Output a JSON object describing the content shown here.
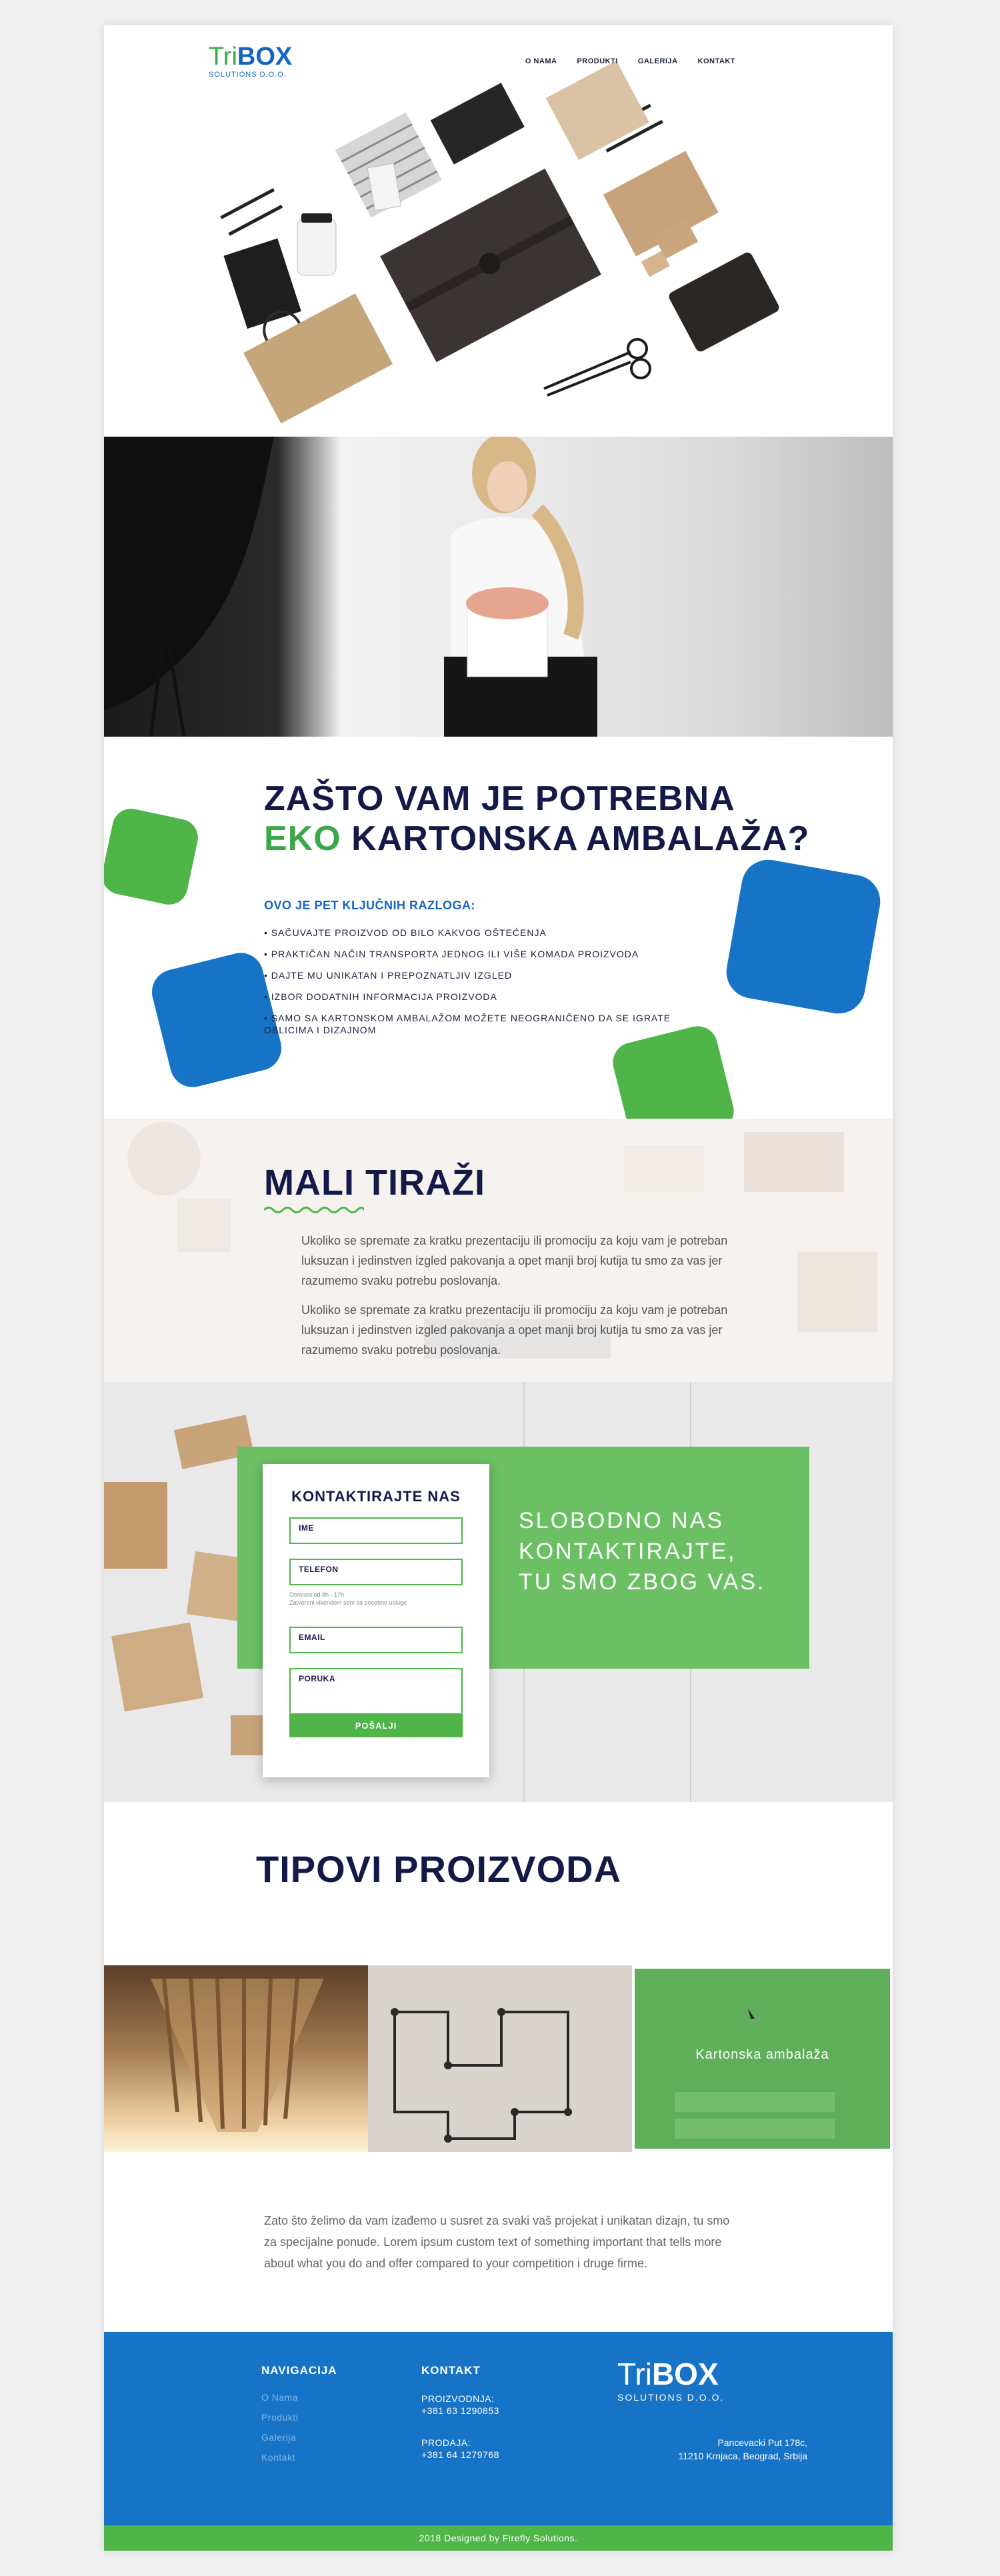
{
  "header": {
    "logo_tri": "Tri",
    "logo_box": "BOX",
    "logo_sub": "SOLUTIONS D.O.O.",
    "nav": [
      "O NAMA",
      "PRODUKTI",
      "GALERIJA",
      "KONTAKT"
    ]
  },
  "why": {
    "title_line1": "ZAŠTO VAM JE POTREBNA",
    "title_eco": "EKO",
    "title_line2_rest": " KARTONSKA AMBALAŽA?",
    "subtitle": "OVO JE PET KLJUČNIH RAZLOGA:",
    "reasons": [
      "• SAČUVAJTE PROIZVOD OD BILO KAKVOG OŠTEĆENJA",
      "• PRAKTIČAN NAČIN TRANSPORTA JEDNOG ILI VIŠE KOMADA PROIZVODA",
      "• DAJTE MU UNIKATAN I PREPOZNATLJIV IZGLED",
      "• IZBOR DODATNIH INFORMACIJA PROIZVODA",
      "• SAMO SA KARTONSKOM AMBALAŽOM MOŽETE NEOGRANIČENO DA SE IGRATE OBLICIMA I DIZAJNOM"
    ]
  },
  "mali": {
    "title": "MALI TIRAŽI",
    "p1": "Ukoliko se spremate za kratku prezentaciju ili promociju za koju vam je potreban luksuzan i jedinstven izgled pakovanja a opet manji broj kutija tu smo za vas jer razumemo svaku potrebu poslovanja.",
    "p2": "Ukoliko se spremate za kratku prezentaciju ili promociju za koju vam je potreban luksuzan i jedinstven izgled pakovanja a opet manji broj kutija tu smo za vas jer razumemo svaku potrebu poslovanja."
  },
  "contact": {
    "form_title": "KONTAKTIRAJTE NAS",
    "name_placeholder": "IME",
    "phone_placeholder": "TELEFON",
    "hours_line1": "Otvoreni od 8h - 17h",
    "hours_line2": "Zatvoreni vikendom sem za posebne usluge",
    "email_placeholder": "EMAIL",
    "message_placeholder": "PORUKA",
    "send_label": "POŠALJI",
    "slogan_line1": "SLOBODNO NAS",
    "slogan_line2": "KONTAKTIRAJTE,",
    "slogan_line3": "TU SMO ZBOG VAS."
  },
  "products": {
    "title": "TIPOVI PROIZVODA",
    "tile_label": "Kartonska ambalaža",
    "about": "Zato što želimo da vam izađemo u susret za svaki vaš projekat i unikatan dizajn, tu smo za specijalne ponude. Lorem ipsum custom text of something important that tells more about what you do and offer compared to your competition i druge firme."
  },
  "footer": {
    "nav_heading": "NAVIGACIJA",
    "nav_links": [
      "O Nama",
      "Produkti",
      "Galerija",
      "Kontakt"
    ],
    "contact_heading": "KONTAKT",
    "prod_label": "PROIZVODNJA:",
    "prod_phone": "+381 63 1290853",
    "sales_label": "PRODAJA:",
    "sales_phone": "+381 64 1279768",
    "logo_tri": "Tri",
    "logo_box": "BOX",
    "logo_sub": "SOLUTIONS D.O.O.",
    "address_line1": "Pancevacki Put 178c,",
    "address_line2": "11210 Krnjaca, Beograd, Srbija",
    "copyright": "2018 Designed by Firefly Solutions."
  },
  "colors": {
    "navy": "#141a48",
    "green": "#4fb548",
    "blue": "#1773c6"
  }
}
